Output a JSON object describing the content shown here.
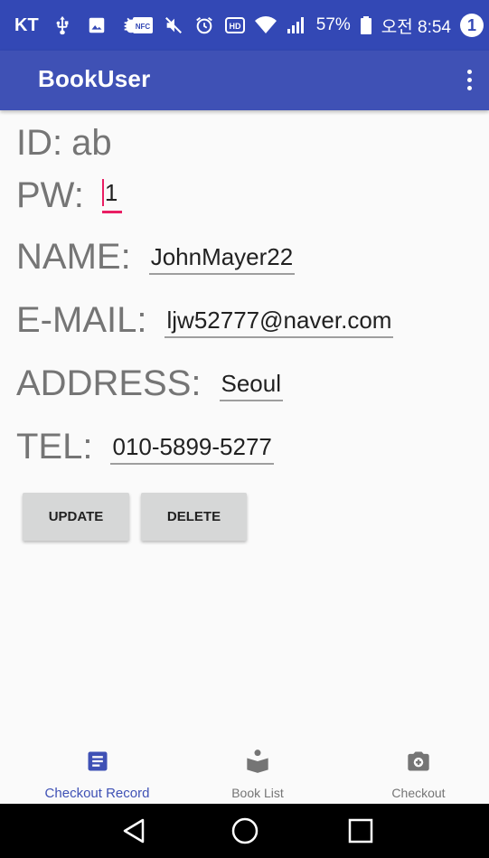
{
  "status_bar": {
    "carrier": "KT",
    "battery": "57%",
    "time": "오전 8:54",
    "notification_count": "1",
    "nfc_label": "NFC",
    "hd_label": "HD"
  },
  "app_bar": {
    "title": "BookUser"
  },
  "form": {
    "id_label": "ID:",
    "id_value": "ab",
    "pw_label": "PW:",
    "pw_value": "1",
    "name_label": "NAME:",
    "name_value": "JohnMayer22",
    "email_label": "E-MAIL:",
    "email_value": "ljw52777@naver.com",
    "address_label": "ADDRESS:",
    "address_value": "Seoul",
    "tel_label": "TEL:",
    "tel_value": "010-5899-5277"
  },
  "buttons": {
    "update": "UPDATE",
    "delete": "DELETE"
  },
  "bottom_nav": {
    "items": [
      {
        "label": "Checkout Record",
        "icon": "article-icon",
        "active": true
      },
      {
        "label": "Book List",
        "icon": "reading-book-icon",
        "active": false
      },
      {
        "label": "Checkout",
        "icon": "camera-icon",
        "active": false
      }
    ]
  },
  "colors": {
    "primary": "#3f51b5",
    "status_bar": "#3348b5",
    "accent": "#e91e63",
    "button_bg": "#d6d7d7"
  }
}
